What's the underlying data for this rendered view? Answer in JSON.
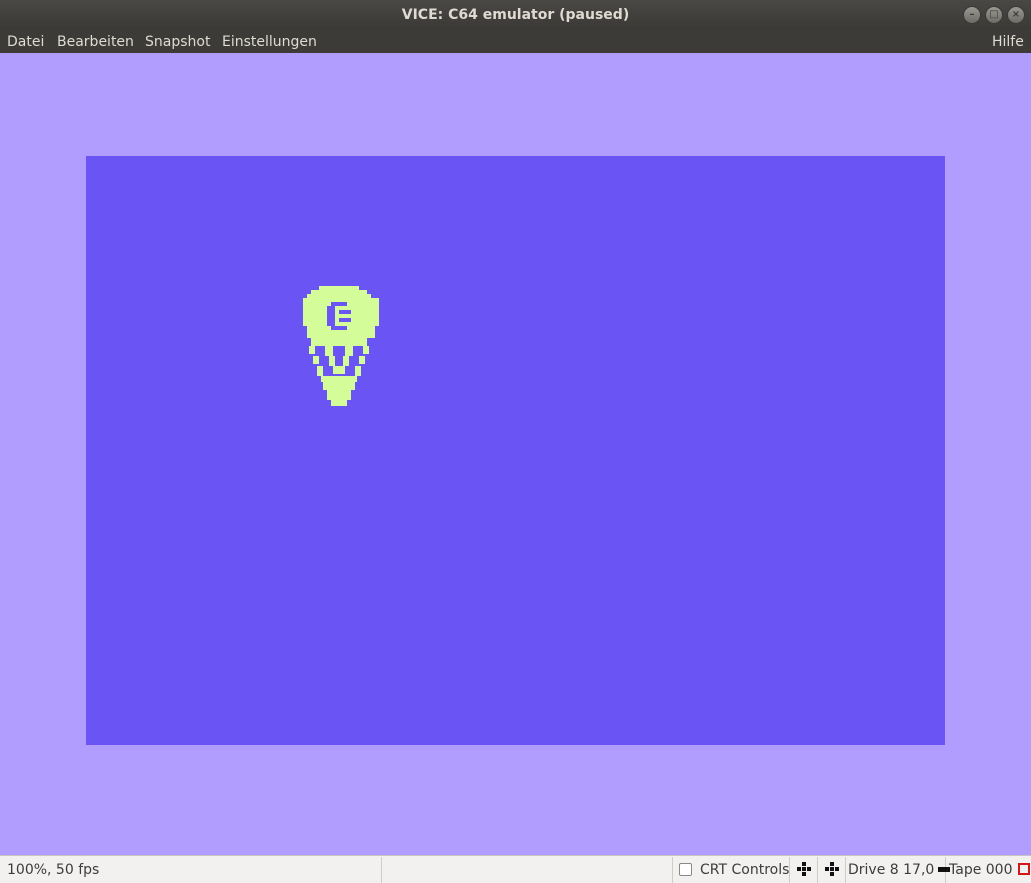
{
  "window": {
    "title": "VICE: C64 emulator (paused)",
    "buttons": {
      "minimize": "–",
      "maximize": "□",
      "close": "×"
    }
  },
  "menu": {
    "datei": "Datei",
    "bearbeiten": "Bearbeiten",
    "snapshot": "Snapshot",
    "einstellungen": "Einstellungen",
    "hilfe": "Hilfe"
  },
  "screen": {
    "border_color": "#b19dfd",
    "background_color": "#6a55f4",
    "sprite_color": "#d4fc99",
    "sprite_icon": "commodore-balloon-sprite"
  },
  "status": {
    "speed": "100%, 50 fps",
    "message": "",
    "crt_label": "CRT Controls",
    "crt_checked": false,
    "joystick1_icon": "joystick-port-1-icon",
    "joystick2_icon": "joystick-port-2-icon",
    "drive": "Drive 8 17,0",
    "tape": "Tape 000"
  }
}
